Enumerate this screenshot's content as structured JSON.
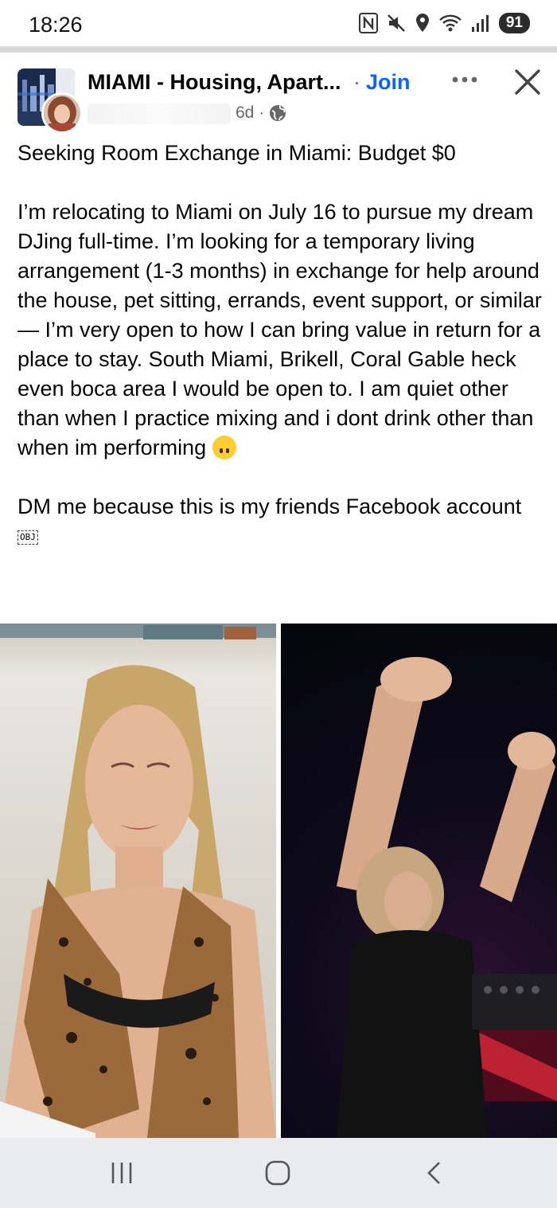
{
  "status_bar": {
    "time": "18:26",
    "battery": "91",
    "icons": [
      "nfc-icon",
      "mute-icon",
      "location-icon",
      "wifi-icon",
      "signal-icon",
      "battery-icon"
    ]
  },
  "header": {
    "group_name": "MIAMI - Housing, Apart...",
    "separator": "·",
    "join_label": "Join",
    "age": "6d ·",
    "visibility_icon": "globe-icon"
  },
  "post": {
    "title": "Seeking Room Exchange in Miami: Budget $0",
    "body": "I’m relocating to Miami on July 16 to pursue my dream DJing full-time. I’m looking for a temporary living arrangement (1-3 months) in exchange for help around the house, pet sitting, errands, event support, or similar — I’m very open to how I can bring value in return for a place to stay. South Miami, Brikell, Coral Gable heck even boca area I would be open to. I am quiet other than when I practice mixing and i dont drink other than when im performing",
    "footer": "DM me because this is my friends Facebook account",
    "object_glyph": "OBJ"
  },
  "photos": [
    "woman-on-beach-photo",
    "dj-performing-photo"
  ],
  "nav_bar": [
    "recent-apps-button",
    "home-button",
    "back-button"
  ],
  "colors": {
    "accent": "#0866ff",
    "text": "#050505",
    "muted": "#65676b"
  }
}
